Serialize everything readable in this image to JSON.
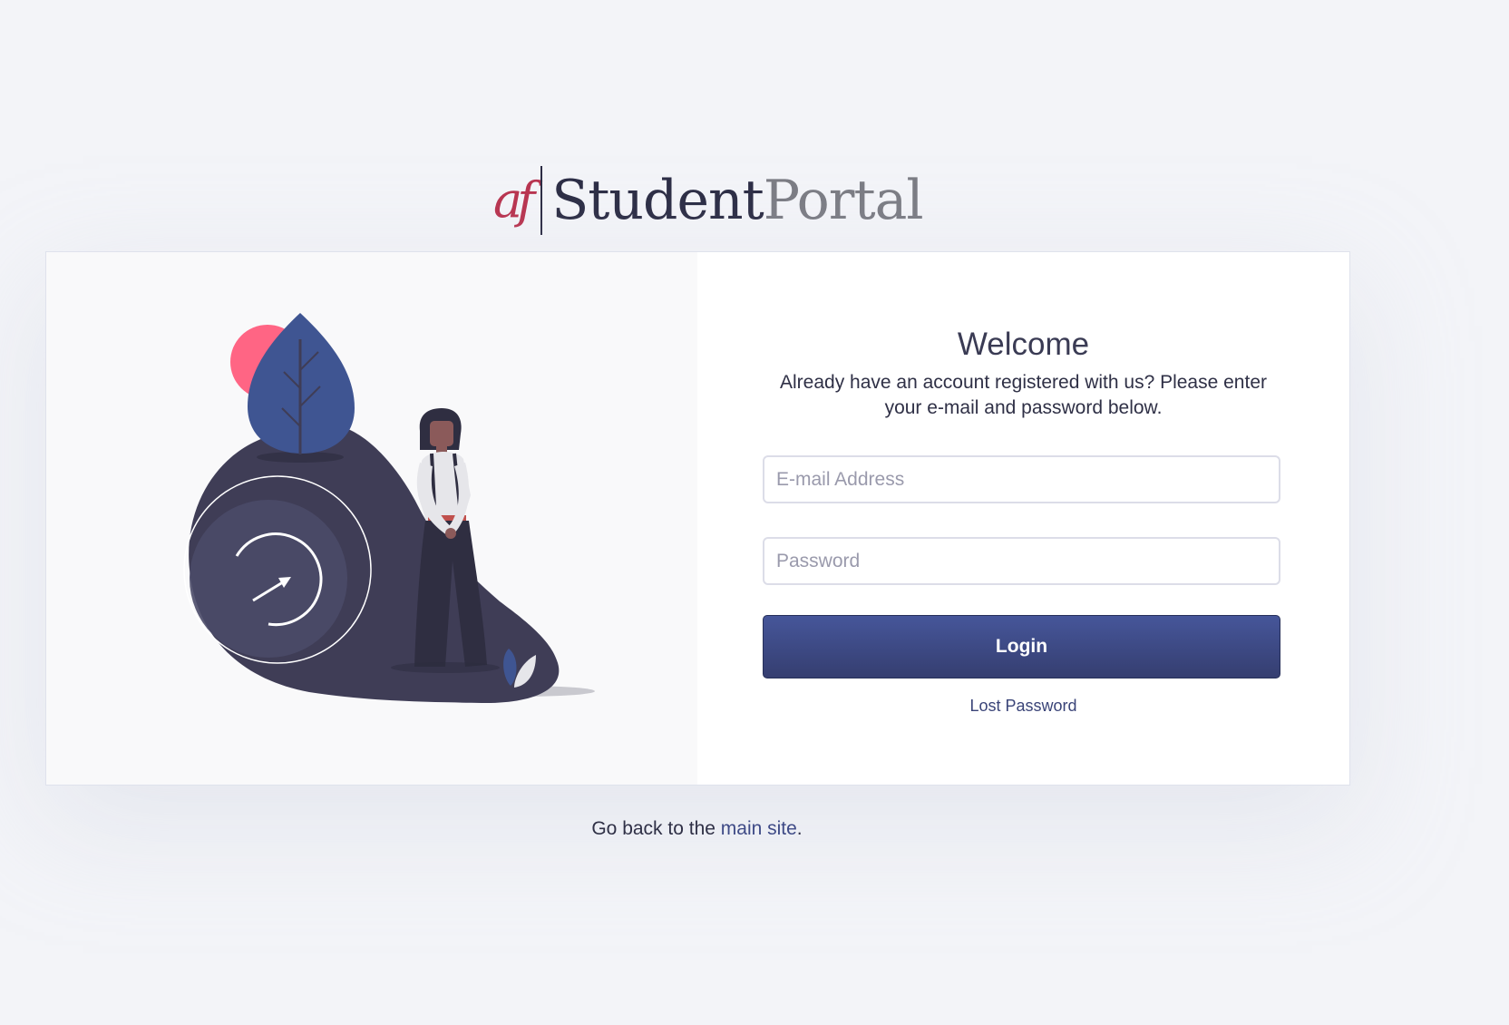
{
  "logo": {
    "mark": "af",
    "word_primary": "Student",
    "word_secondary": "Portal"
  },
  "login": {
    "title": "Welcome",
    "subtitle": "Already have an account registered with us? Please enter your e-mail and password below.",
    "email_placeholder": "E-mail Address",
    "password_placeholder": "Password",
    "login_label": "Login",
    "lost_password_label": "Lost Password"
  },
  "footer": {
    "prefix": "Go back to the ",
    "link_label": "main site",
    "suffix": "."
  },
  "colors": {
    "accent": "#3e4a86",
    "brand_red": "#b8334f",
    "background": "#f3f4f8"
  },
  "icons": {
    "illustration": "woman-with-plant-and-timer"
  }
}
